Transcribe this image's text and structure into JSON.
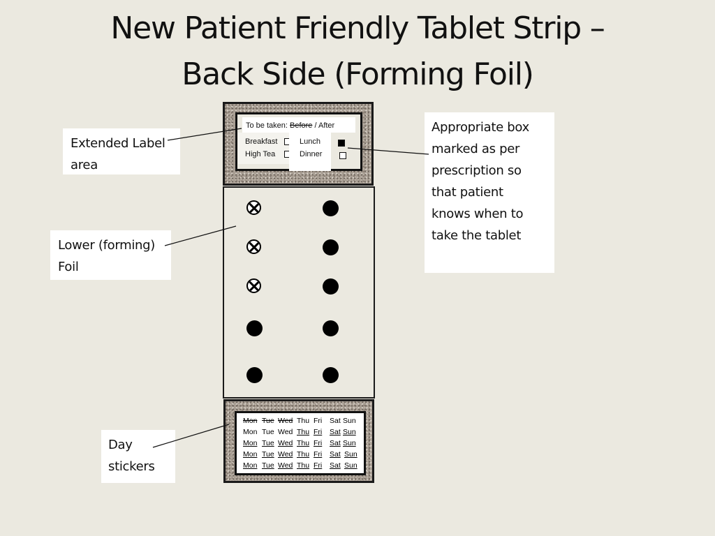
{
  "slide": {
    "title_lines": [
      "New Patient Friendly Tablet Strip –",
      "Back Side (Forming Foil)"
    ]
  },
  "callouts": {
    "extended_label": [
      "Extended Label",
      "area"
    ],
    "lower_foil": [
      "Lower (forming)",
      "Foil"
    ],
    "day_stickers": [
      "Day",
      "stickers"
    ],
    "appropriate_box": [
      "Appropriate box",
      "marked as per",
      "prescription so",
      "that patient",
      "knows when to",
      "take the tablet"
    ]
  },
  "label_area": {
    "taken_prefix": "To be taken:",
    "before": "Before",
    "before_struck": true,
    "separator": " / ",
    "after": "After",
    "meals": [
      {
        "name": "Breakfast",
        "checked": false
      },
      {
        "name": "High Tea",
        "checked": false
      },
      {
        "name": "Lunch",
        "checked": true
      },
      {
        "name": "Dinner",
        "checked": false
      }
    ]
  },
  "blister": {
    "columns": 2,
    "rows": 5,
    "pills": [
      [
        "taken",
        "present"
      ],
      [
        "taken",
        "present"
      ],
      [
        "taken",
        "present"
      ],
      [
        "present",
        "present"
      ],
      [
        "present",
        "present"
      ]
    ]
  },
  "day_stickers": {
    "days": [
      "Mon",
      "Tue",
      "Wed",
      "Thu",
      "Fri",
      "Sat",
      "Sun"
    ],
    "rows": [
      {
        "style": [
          "strike",
          "strike",
          "strike",
          "none",
          "none",
          "none",
          "none"
        ]
      },
      {
        "style": [
          "none",
          "none",
          "none",
          "underline",
          "underline",
          "underline",
          "underline"
        ]
      },
      {
        "style": [
          "underline",
          "underline",
          "underline",
          "underline",
          "underline",
          "underline",
          "underline"
        ]
      },
      {
        "style": [
          "underline",
          "underline",
          "underline",
          "underline",
          "underline",
          "underline",
          "underline"
        ]
      },
      {
        "style": [
          "underline",
          "underline",
          "underline",
          "underline",
          "underline",
          "underline",
          "underline"
        ]
      }
    ]
  },
  "colors": {
    "background": "#ebe9e0",
    "granite": "#a79d92",
    "border": "#1a1a1a",
    "pill": "#000000",
    "callout_bg": "#ffffff"
  }
}
